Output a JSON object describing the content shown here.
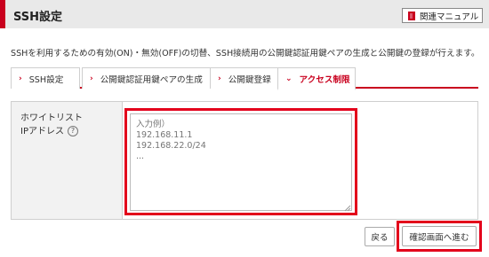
{
  "header": {
    "title": "SSH設定",
    "manual_label": "関連マニュアル"
  },
  "description": "SSHを利用するための有効(ON)・無効(OFF)の切替、SSH接続用の公開鍵認証用鍵ペアの生成と公開鍵の登録が行えます。",
  "tabs": [
    {
      "label": "SSH設定",
      "active": false
    },
    {
      "label": "公開鍵認証用鍵ペアの生成",
      "active": false
    },
    {
      "label": "公開鍵登録",
      "active": false
    },
    {
      "label": "アクセス制限",
      "active": true
    }
  ],
  "form": {
    "field_label_line1": "ホワイトリスト",
    "field_label_line2": "IPアドレス",
    "help_glyph": "?",
    "placeholder": "入力例）\n192.168.11.1\n192.168.22.0/24\n...",
    "value": ""
  },
  "buttons": {
    "back_label": "戻る",
    "next_label": "確認画面へ進む"
  },
  "colors": {
    "accent": "#c9001e",
    "highlight": "#e3001b",
    "header_bg": "#e9e9e9",
    "label_bg": "#f2f2f2"
  }
}
